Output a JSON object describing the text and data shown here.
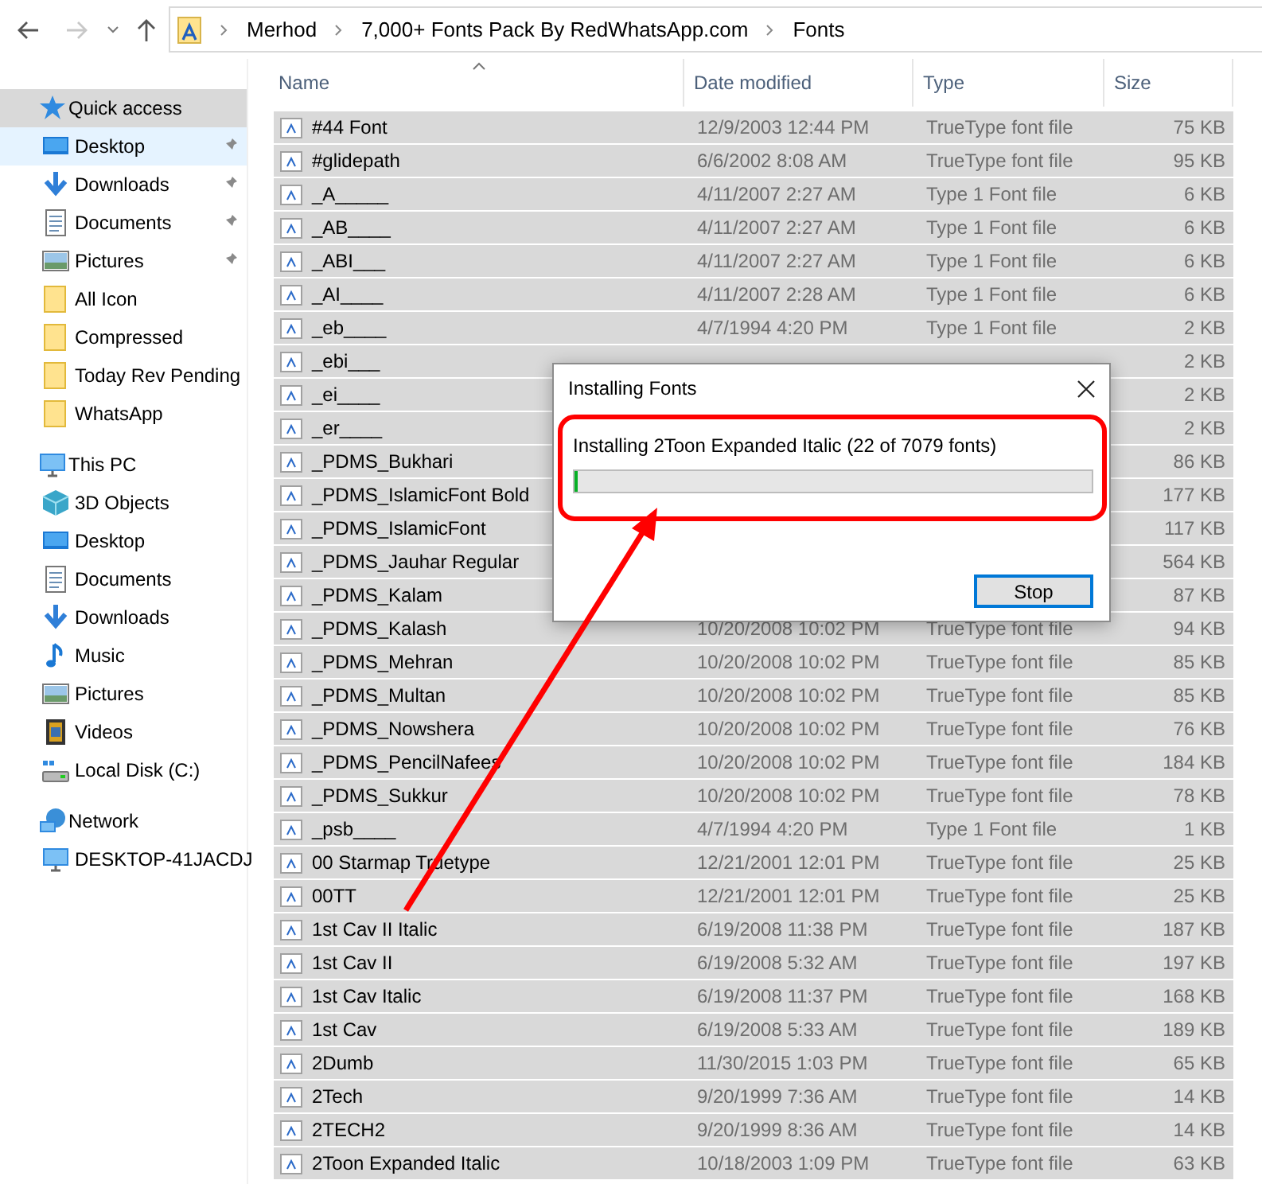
{
  "navigation": {
    "back_enabled": true,
    "forward_enabled": false,
    "address": [
      "Merhod",
      "7,000+ Fonts Pack By RedWhatsApp.com",
      "Fonts"
    ]
  },
  "sidebar": [
    {
      "label": "Quick access",
      "kind": "star",
      "selected": true,
      "hovered": false,
      "children": [
        {
          "label": "Desktop",
          "kind": "desktop",
          "pinned": true,
          "selected": false,
          "hovered": true
        },
        {
          "label": "Downloads",
          "kind": "download",
          "pinned": true,
          "selected": false,
          "hovered": false
        },
        {
          "label": "Documents",
          "kind": "document",
          "pinned": true,
          "selected": false,
          "hovered": false
        },
        {
          "label": "Pictures",
          "kind": "picture",
          "pinned": true,
          "selected": false,
          "hovered": false
        },
        {
          "label": "All Icon",
          "kind": "folder",
          "pinned": false,
          "selected": false,
          "hovered": false
        },
        {
          "label": "Compressed",
          "kind": "folder",
          "pinned": false,
          "selected": false,
          "hovered": false
        },
        {
          "label": "Today Rev Pending",
          "kind": "folder",
          "pinned": false,
          "selected": false,
          "hovered": false
        },
        {
          "label": "WhatsApp",
          "kind": "folder",
          "pinned": false,
          "selected": false,
          "hovered": false
        }
      ]
    },
    {
      "label": "This PC",
      "kind": "pc",
      "selected": false,
      "hovered": false,
      "children": [
        {
          "label": "3D Objects",
          "kind": "cube",
          "pinned": false,
          "selected": false,
          "hovered": false
        },
        {
          "label": "Desktop",
          "kind": "desktop",
          "pinned": false,
          "selected": false,
          "hovered": false
        },
        {
          "label": "Documents",
          "kind": "document",
          "pinned": false,
          "selected": false,
          "hovered": false
        },
        {
          "label": "Downloads",
          "kind": "download",
          "pinned": false,
          "selected": false,
          "hovered": false
        },
        {
          "label": "Music",
          "kind": "music",
          "pinned": false,
          "selected": false,
          "hovered": false
        },
        {
          "label": "Pictures",
          "kind": "picture",
          "pinned": false,
          "selected": false,
          "hovered": false
        },
        {
          "label": "Videos",
          "kind": "video",
          "pinned": false,
          "selected": false,
          "hovered": false
        },
        {
          "label": "Local Disk (C:)",
          "kind": "disk",
          "pinned": false,
          "selected": false,
          "hovered": false
        }
      ]
    },
    {
      "label": "Network",
      "kind": "network",
      "selected": false,
      "hovered": false,
      "children": [
        {
          "label": "DESKTOP-41JACDJ",
          "kind": "pc",
          "pinned": false,
          "selected": false,
          "hovered": false
        }
      ]
    }
  ],
  "table": {
    "columns": [
      {
        "label": "Name",
        "sorted": true
      },
      {
        "label": "Date modified",
        "sorted": false
      },
      {
        "label": "Type",
        "sorted": false
      },
      {
        "label": "Size",
        "sorted": false
      }
    ],
    "rows": [
      {
        "name": "#44 Font",
        "date": "12/9/2003 12:44 PM",
        "type": "TrueType font file",
        "size": "75 KB",
        "selected": true
      },
      {
        "name": "#glidepath",
        "date": "6/6/2002 8:08 AM",
        "type": "TrueType font file",
        "size": "95 KB",
        "selected": true
      },
      {
        "name": "_A_____",
        "date": "4/11/2007 2:27 AM",
        "type": "Type 1 Font file",
        "size": "6 KB",
        "selected": true
      },
      {
        "name": "_AB____",
        "date": "4/11/2007 2:27 AM",
        "type": "Type 1 Font file",
        "size": "6 KB",
        "selected": true
      },
      {
        "name": "_ABI___",
        "date": "4/11/2007 2:27 AM",
        "type": "Type 1 Font file",
        "size": "6 KB",
        "selected": true
      },
      {
        "name": "_AI____",
        "date": "4/11/2007 2:28 AM",
        "type": "Type 1 Font file",
        "size": "6 KB",
        "selected": true
      },
      {
        "name": "_eb____",
        "date": "4/7/1994 4:20 PM",
        "type": "Type 1 Font file",
        "size": "2 KB",
        "selected": true
      },
      {
        "name": "_ebi___",
        "size": "2 KB",
        "selected": true
      },
      {
        "name": "_ei____",
        "size": "2 KB",
        "selected": true
      },
      {
        "name": "_er____",
        "size": "2 KB",
        "selected": true
      },
      {
        "name": "_PDMS_Bukhari",
        "size": "86 KB",
        "selected": true
      },
      {
        "name": "_PDMS_IslamicFont Bold",
        "size": "177 KB",
        "selected": true
      },
      {
        "name": "_PDMS_IslamicFont",
        "size": "117 KB",
        "selected": true
      },
      {
        "name": "_PDMS_Jauhar Regular",
        "size": "564 KB",
        "selected": true
      },
      {
        "name": "_PDMS_Kalam",
        "size": "87 KB",
        "selected": true
      },
      {
        "name": "_PDMS_Kalash",
        "date": "10/20/2008 10:02 PM",
        "type": "TrueType font file",
        "size": "94 KB",
        "selected": true
      },
      {
        "name": "_PDMS_Mehran",
        "date": "10/20/2008 10:02 PM",
        "type": "TrueType font file",
        "size": "85 KB",
        "selected": true
      },
      {
        "name": "_PDMS_Multan",
        "date": "10/20/2008 10:02 PM",
        "type": "TrueType font file",
        "size": "85 KB",
        "selected": true
      },
      {
        "name": "_PDMS_Nowshera",
        "date": "10/20/2008 10:02 PM",
        "type": "TrueType font file",
        "size": "76 KB",
        "selected": true
      },
      {
        "name": "_PDMS_PencilNafees",
        "date": "10/20/2008 10:02 PM",
        "type": "TrueType font file",
        "size": "184 KB",
        "selected": true
      },
      {
        "name": "_PDMS_Sukkur",
        "date": "10/20/2008 10:02 PM",
        "type": "TrueType font file",
        "size": "78 KB",
        "selected": true
      },
      {
        "name": "_psb____",
        "date": "4/7/1994 4:20 PM",
        "type": "Type 1 Font file",
        "size": "1 KB",
        "selected": true
      },
      {
        "name": "00 Starmap Truetype",
        "date": "12/21/2001 12:01 PM",
        "type": "TrueType font file",
        "size": "25 KB",
        "selected": true
      },
      {
        "name": "00TT",
        "date": "12/21/2001 12:01 PM",
        "type": "TrueType font file",
        "size": "25 KB",
        "selected": true
      },
      {
        "name": "1st Cav II Italic",
        "date": "6/19/2008 11:38 PM",
        "type": "TrueType font file",
        "size": "187 KB",
        "selected": true
      },
      {
        "name": "1st Cav II",
        "date": "6/19/2008 5:32 AM",
        "type": "TrueType font file",
        "size": "197 KB",
        "selected": true
      },
      {
        "name": "1st Cav Italic",
        "date": "6/19/2008 11:37 PM",
        "type": "TrueType font file",
        "size": "168 KB",
        "selected": true
      },
      {
        "name": "1st Cav",
        "date": "6/19/2008 5:33 AM",
        "type": "TrueType font file",
        "size": "189 KB",
        "selected": true
      },
      {
        "name": "2Dumb",
        "date": "11/30/2015 1:03 PM",
        "type": "TrueType font file",
        "size": "65 KB",
        "selected": true
      },
      {
        "name": "2Tech",
        "date": "9/20/1999 7:36 AM",
        "type": "TrueType font file",
        "size": "14 KB",
        "selected": true
      },
      {
        "name": "2TECH2",
        "date": "9/20/1999 8:36 AM",
        "type": "TrueType font file",
        "size": "14 KB",
        "selected": true
      },
      {
        "name": "2Toon Expanded Italic",
        "date": "10/18/2003 1:09 PM",
        "type": "TrueType font file",
        "size": "63 KB",
        "selected": true
      }
    ]
  },
  "dialog": {
    "title": "Installing Fonts",
    "message": "Installing 2Toon Expanded Italic (22 of 7079 fonts)",
    "progress": {
      "level": 0.004
    },
    "button": {
      "label": "Stop",
      "focused": true
    }
  }
}
